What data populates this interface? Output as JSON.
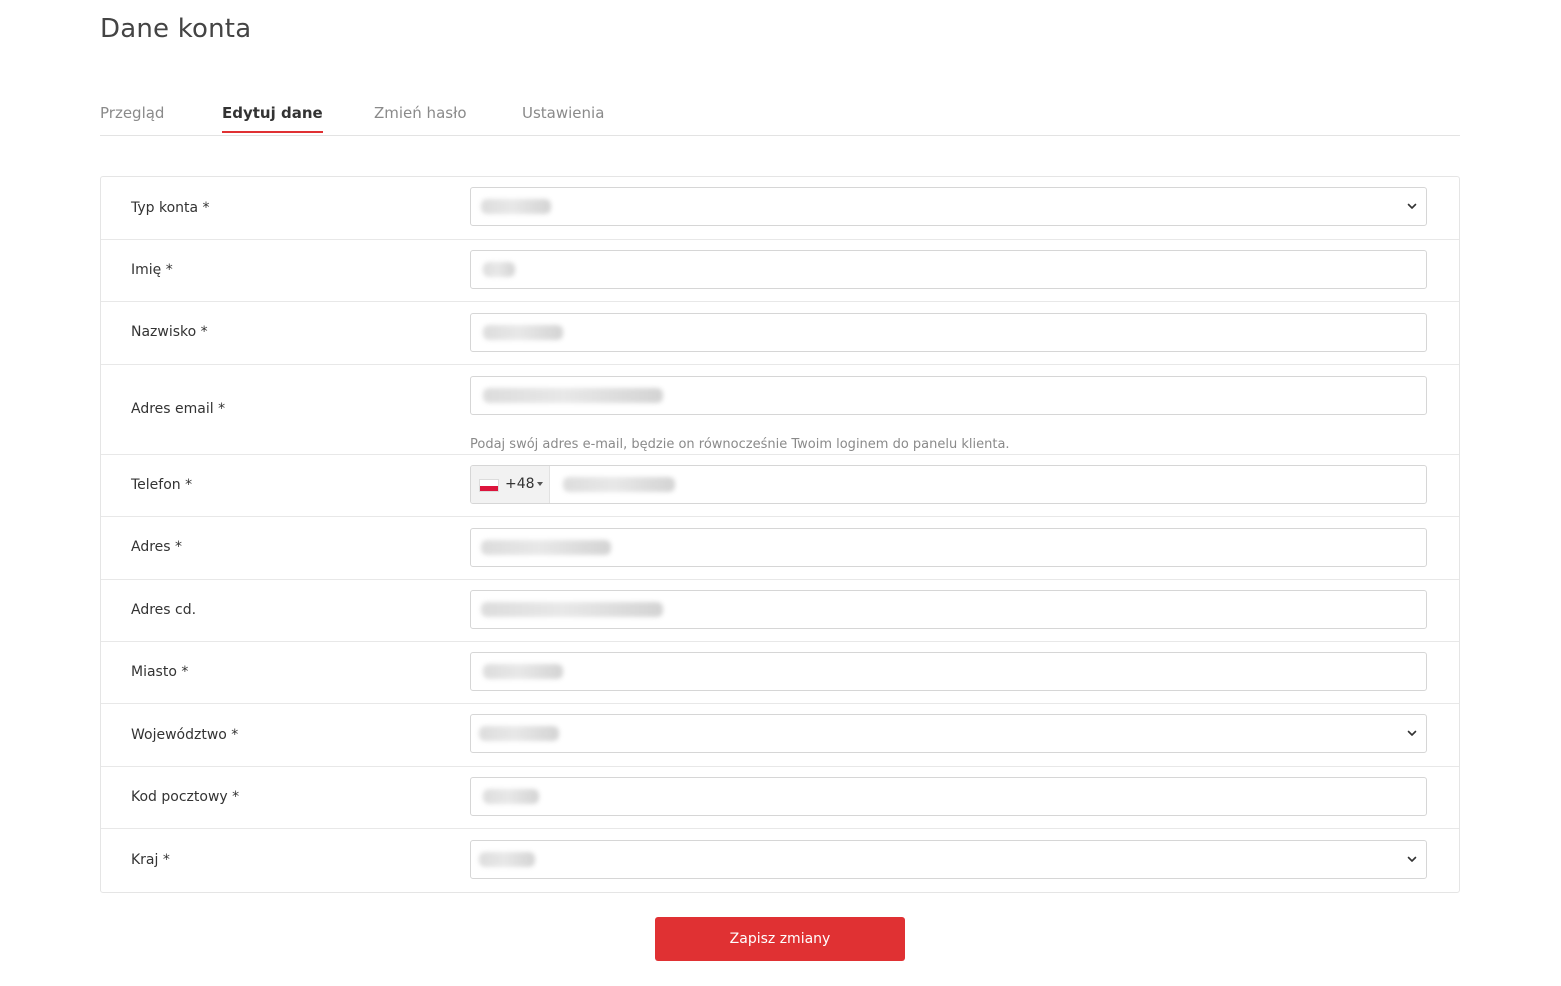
{
  "page": {
    "title": "Dane konta"
  },
  "tabs": [
    {
      "label": "Przegląd",
      "active": false
    },
    {
      "label": "Edytuj dane",
      "active": true
    },
    {
      "label": "Zmień hasło",
      "active": false
    },
    {
      "label": "Ustawienia",
      "active": false
    }
  ],
  "form": {
    "rows": [
      {
        "label": "Typ konta *",
        "type": "select",
        "value_visible": false
      },
      {
        "label": "Imię *",
        "type": "text",
        "value_visible": false
      },
      {
        "label": "Nazwisko *",
        "type": "text",
        "value_visible": false
      },
      {
        "label": "Adres email *",
        "type": "email",
        "value_visible": false,
        "help": "Podaj swój adres e-mail, będzie on równocześnie Twoim loginem do panelu klienta."
      },
      {
        "label": "Telefon *",
        "type": "tel",
        "value_visible": false,
        "country_flag": "poland-flag-icon",
        "dial_code": "+48"
      },
      {
        "label": "Adres *",
        "type": "text",
        "value_visible": false
      },
      {
        "label": "Adres cd.",
        "type": "text",
        "value_visible": false
      },
      {
        "label": "Miasto *",
        "type": "text",
        "value_visible": false
      },
      {
        "label": "Województwo *",
        "type": "select",
        "value_visible": false
      },
      {
        "label": "Kod pocztowy *",
        "type": "text",
        "value_visible": false
      },
      {
        "label": "Kraj *",
        "type": "select",
        "value_visible": false
      }
    ],
    "submit_label": "Zapisz zmiany"
  },
  "colors": {
    "accent": "#e03133",
    "text": "#333333",
    "muted": "#8a8a8a",
    "border": "#d6d6d6"
  },
  "icons": {
    "select_arrow": "chevron-down-icon",
    "phone_dropdown": "caret-down-icon"
  }
}
